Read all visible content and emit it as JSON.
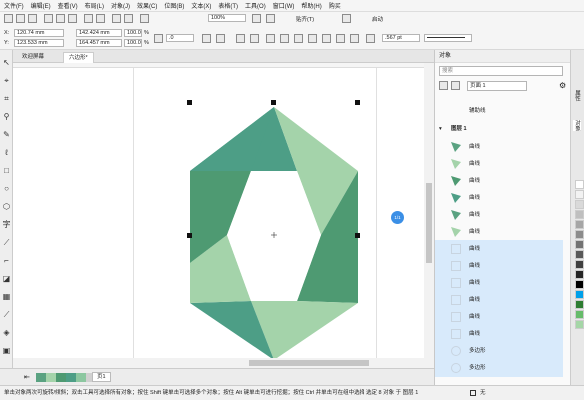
{
  "menu": {
    "items": [
      "文件(F)",
      "编辑(E)",
      "查看(V)",
      "布局(L)",
      "对象(J)",
      "效果(C)",
      "位图(B)",
      "文本(X)",
      "表格(T)",
      "工具(O)",
      "窗口(W)",
      "帮助(H)",
      "购买"
    ],
    "zoom": "100%",
    "snap_label": "贴齐(T)",
    "launch_label": "启动"
  },
  "propbar": {
    "x_label": "X:",
    "x_value": "120.74 mm",
    "y_label": "Y:",
    "y_value": "123.533 mm",
    "w_value": "142.424 mm",
    "h_value": "164.457 mm",
    "sx_value": "100.0",
    "sy_value": "100.0",
    "pct1": "%",
    "pct2": "%",
    "angle_value": ".0",
    "outline_width": ".567 pt"
  },
  "tabs": {
    "welcome": "欢迎屏幕",
    "doc": "六边形*"
  },
  "canvas": {
    "marker_label": "1/1",
    "fill_dark": "#5aa281",
    "fill_mid": "#4e9a72",
    "fill_light": "#a4d3aa",
    "fill_teal": "#4d9e86"
  },
  "pagebar": {
    "page_label": "页1"
  },
  "statusbar": {
    "hint": "单击对象两次可旋转/倾斜；双击工具可选择所有对象；按住 Shift 键单击可选择多个对象；按住 Alt 键单击可进行挖掘；按住 Ctrl 并单击可在组中选择",
    "selection": "选定 8 对象 于 图层 1",
    "fill_label": "无"
  },
  "objects_panel": {
    "title": "对象",
    "search_placeholder": "搜索",
    "page_label": "页面 1",
    "guides_label": "辅助线",
    "layer_label": "图层 1",
    "items": [
      {
        "label": "曲线",
        "selected": false
      },
      {
        "label": "曲线",
        "selected": false
      },
      {
        "label": "曲线",
        "selected": false
      },
      {
        "label": "曲线",
        "selected": false
      },
      {
        "label": "曲线",
        "selected": false
      },
      {
        "label": "曲线",
        "selected": false
      },
      {
        "label": "曲线",
        "selected": true
      },
      {
        "label": "曲线",
        "selected": true
      },
      {
        "label": "曲线",
        "selected": true
      },
      {
        "label": "曲线",
        "selected": true
      },
      {
        "label": "曲线",
        "selected": true
      },
      {
        "label": "曲线",
        "selected": true
      },
      {
        "label": "多边形",
        "selected": true
      },
      {
        "label": "多边形",
        "selected": true
      }
    ]
  },
  "dock_tabs": [
    "属性",
    "对象"
  ],
  "palette": [
    "#ffffff",
    "#f2f2f2",
    "#d9d9d9",
    "#bfbfbf",
    "#a6a6a6",
    "#8c8c8c",
    "#737373",
    "#595959",
    "#404040",
    "#262626",
    "#000000",
    "#00a0e9",
    "#2e7d32",
    "#66bb6a",
    "#a5d6a7"
  ]
}
